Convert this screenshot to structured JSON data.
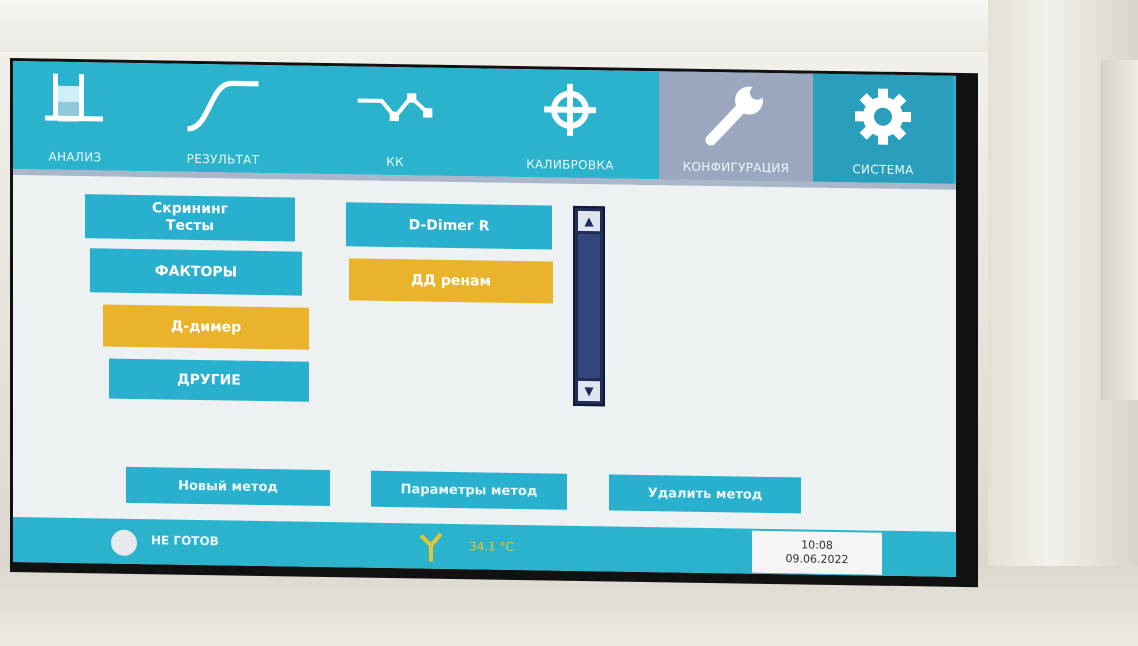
{
  "nav": {
    "tabs": [
      {
        "label": "АНАЛИЗ",
        "icon": "test-tube-icon"
      },
      {
        "label": "РЕЗУЛЬТАТ",
        "icon": "curve-icon"
      },
      {
        "label": "КК",
        "icon": "qc-chart-icon"
      },
      {
        "label": "КАЛИБРОВКА",
        "icon": "crosshair-icon"
      },
      {
        "label": "КОНФИГУРАЦИЯ",
        "icon": "wrench-icon",
        "active": true
      },
      {
        "label": "СИСТЕМА",
        "icon": "gear-icon"
      }
    ]
  },
  "categories": {
    "items": [
      {
        "label": "Скрининг\nТесты",
        "state": "normal"
      },
      {
        "label": "ФАКТОРЫ",
        "state": "normal"
      },
      {
        "label": "Д-димер",
        "state": "selected"
      },
      {
        "label": "ДРУГИЕ",
        "state": "normal"
      }
    ]
  },
  "methods": {
    "items": [
      {
        "label": "D-Dimer R",
        "state": "normal"
      },
      {
        "label": "ДД ренам",
        "state": "selected"
      }
    ]
  },
  "actions": {
    "new_method": "Новый метод",
    "method_params": "Параметры метод",
    "delete_method": "Удалить метод"
  },
  "status": {
    "state_text": "НЕ ГОТОВ",
    "temperature": "34.1 °C",
    "time": "10:08",
    "date": "09.06.2022"
  },
  "colors": {
    "accent": "#2bb3cd",
    "selected": "#e9b32b",
    "active_tab": "#9aa7bf",
    "scrollbar": "#1f2d57"
  }
}
